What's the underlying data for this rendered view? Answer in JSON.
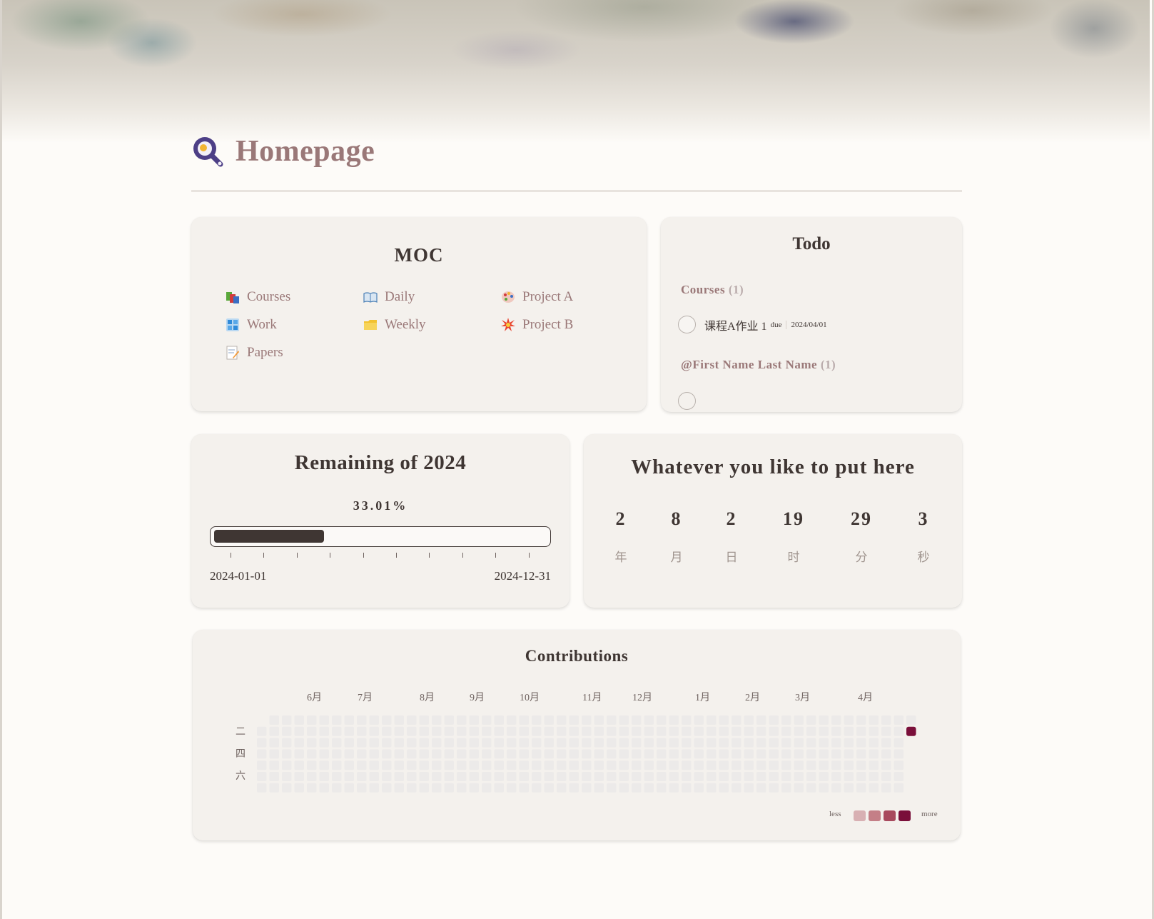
{
  "page": {
    "title": "Homepage",
    "icon": "magnifier-egg-icon"
  },
  "moc": {
    "title": "MOC",
    "items": [
      {
        "label": "Courses",
        "icon": "books-icon"
      },
      {
        "label": "Daily",
        "icon": "open-book-icon"
      },
      {
        "label": "Project A",
        "icon": "palette-icon"
      },
      {
        "label": "Work",
        "icon": "windows-grid-icon"
      },
      {
        "label": "Weekly",
        "icon": "folder-icon"
      },
      {
        "label": "Project B",
        "icon": "collision-icon"
      },
      {
        "label": "Papers",
        "icon": "memo-icon"
      }
    ]
  },
  "todo": {
    "title": "Todo",
    "groups": [
      {
        "name": "Courses",
        "count": "(1)"
      },
      {
        "name": "@First Name Last Name",
        "count": "(1)"
      }
    ],
    "items": [
      {
        "text": "课程A作业 1",
        "due_label": "due",
        "due_date": "2024/04/01",
        "checked": false
      }
    ]
  },
  "remaining": {
    "title": "Remaining of 2024",
    "percent_label": "33.01%",
    "progress": 0.3301,
    "start_date": "2024-01-01",
    "end_date": "2024-12-31"
  },
  "countdown": {
    "title": "Whatever you like to put here",
    "parts": [
      {
        "value": "2",
        "unit": "年"
      },
      {
        "value": "8",
        "unit": "月"
      },
      {
        "value": "2",
        "unit": "日"
      },
      {
        "value": "19",
        "unit": "时"
      },
      {
        "value": "29",
        "unit": "分"
      },
      {
        "value": "3",
        "unit": "秒"
      }
    ]
  },
  "contributions": {
    "title": "Contributions",
    "months": [
      "6月",
      "7月",
      "8月",
      "9月",
      "10月",
      "11月",
      "12月",
      "1月",
      "2月",
      "3月",
      "4月"
    ],
    "weekday_labels": [
      "二",
      "四",
      "六"
    ],
    "weeks": 53,
    "active_cell": {
      "week": 52,
      "day": 1,
      "level": 4
    },
    "legend_less": "less",
    "legend_more": "more",
    "colors": {
      "empty": "#eceae9",
      "l1": "#d8b0b3",
      "l2": "#c47f87",
      "l3": "#a84a5e",
      "l4": "#7a0f3a"
    }
  },
  "theme": {
    "title_color": "#9a7878",
    "text_color": "#3f3633",
    "card_bg": "#f4f1ed"
  }
}
